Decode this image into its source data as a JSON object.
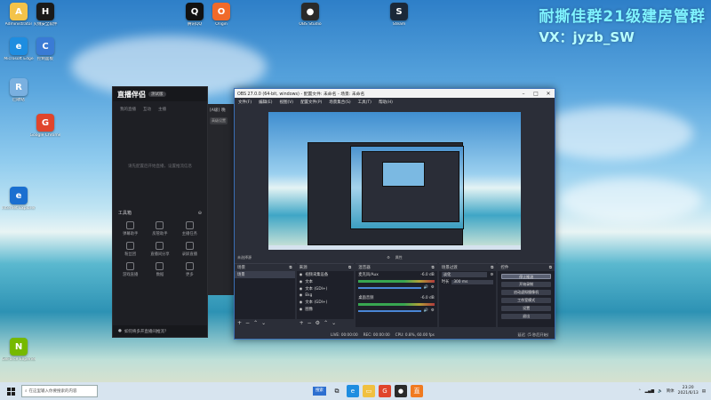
{
  "watermark": {
    "line1": "耐撕佳群21级建房管群",
    "line2": "VX：jyzb_SW"
  },
  "desktop_icons": [
    {
      "label": "Administrator",
      "color": "#f3c34a",
      "glyph": "A"
    },
    {
      "label": "火绒安全软件",
      "color": "#1a1a1a",
      "glyph": "H"
    },
    {
      "label": "Microsoft Edge",
      "color": "#1e8de0",
      "glyph": "e"
    },
    {
      "label": "控制面板",
      "color": "#3a7bd5",
      "glyph": "C"
    },
    {
      "label": "Google Chrome",
      "color": "#e0452c",
      "glyph": "G"
    },
    {
      "label": "回收站",
      "color": "#7ab0e0",
      "glyph": "R"
    },
    {
      "label": "Internet Explorer",
      "color": "#1a6fd0",
      "glyph": "e"
    },
    {
      "label": "腾讯QQ",
      "color": "#111",
      "glyph": "Q"
    },
    {
      "label": "Origin",
      "color": "#f06a2a",
      "glyph": "O"
    },
    {
      "label": "Steam",
      "color": "#1b2838",
      "glyph": "S"
    },
    {
      "label": "OBS Studio",
      "color": "#2a2a2a",
      "glyph": "●"
    },
    {
      "label": "GeForce Experience",
      "color": "#76b900",
      "glyph": "N"
    }
  ],
  "zb": {
    "logo": "直播伴侣",
    "version": "测试版",
    "tabs": [
      "我的直播",
      "互动",
      "主播"
    ],
    "hint": "请先配置后开始直播，设置推流信息",
    "tools_label": "工具箱",
    "tools": [
      "弹幕助手",
      "房管助手",
      "主播任务",
      "粉丝团",
      "直播间分享",
      "录屏直播",
      "游戏直播",
      "数据",
      "更多"
    ],
    "bottom_text": "如何将多开直播间推流？",
    "ext_tab1": "[A级]",
    "ext_tab2": "晚",
    "ext_btn": "高级设置"
  },
  "obs": {
    "title": "OBS 27.0.0 (64-bit, windows) - 配置文件: 未命名 - 场景: 未命名",
    "menu": [
      "文件(F)",
      "编辑(E)",
      "视图(V)",
      "配置文件(P)",
      "场景集合(S)",
      "工具(T)",
      "帮助(H)"
    ],
    "preview_label": "未选择源",
    "filter_btn": "属性",
    "scenes_header": "场景",
    "sources_header": "来源",
    "scene_name": "场景",
    "sources": [
      "视频采集设备",
      "文本",
      "文本 (GDI+)",
      "Ekg",
      "文本 (GDI+)",
      "图像"
    ],
    "mixer_header": "混音器",
    "mixer_tracks": [
      {
        "name": "麦克风/Aux",
        "db": "-6.0 dB"
      },
      {
        "name": "桌面音频",
        "db": "-6.0 dB"
      }
    ],
    "transitions_header": "场景过渡",
    "transition_type": "淡化",
    "duration_label": "时长",
    "duration_value": "300 ms",
    "controls_header": "控件",
    "controls": [
      "停止推流",
      "开始录制",
      "启动虚拟摄像机",
      "工作室模式",
      "设置",
      "退出"
    ],
    "status": {
      "live": "LIVE: 00:00:00",
      "rec": "REC: 00:00:00",
      "cpu": "CPU: 0.8%, 60.00 fps",
      "right": "延迟（5 秒后开始）"
    }
  },
  "taskbar": {
    "search_placeholder": "在这里输入你要搜索的内容",
    "search_btn": "搜索",
    "time": "23:20",
    "date": "2021/6/13",
    "ime": "简体"
  },
  "colors": {
    "accent": "#3b6fb6",
    "obs_bg": "#2b2e38",
    "taskbar": "#d7e4ef"
  }
}
